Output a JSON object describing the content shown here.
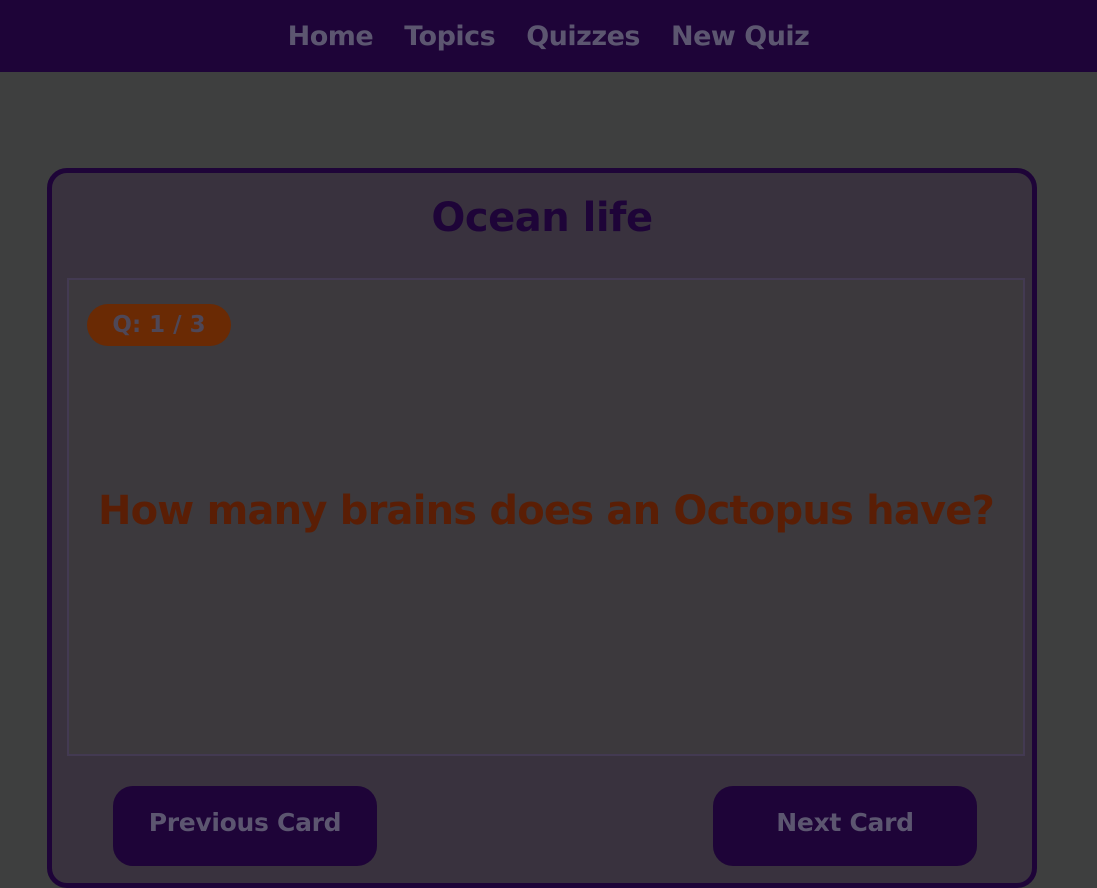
{
  "nav": {
    "links": [
      "Home",
      "Topics",
      "Quizzes",
      "New Quiz"
    ]
  },
  "deck": {
    "title": "Ocean life"
  },
  "card": {
    "counter": "Q: 1 / 3",
    "question": "How many brains does an Octopus have?"
  },
  "buttons": {
    "previous": "Previous Card",
    "next": "Next Card"
  },
  "colors": {
    "navbar_bg": "#1e0438",
    "page_bg": "#3e3f3f",
    "accent_orange": "#6a2a04",
    "question_text": "#5a1e05"
  }
}
